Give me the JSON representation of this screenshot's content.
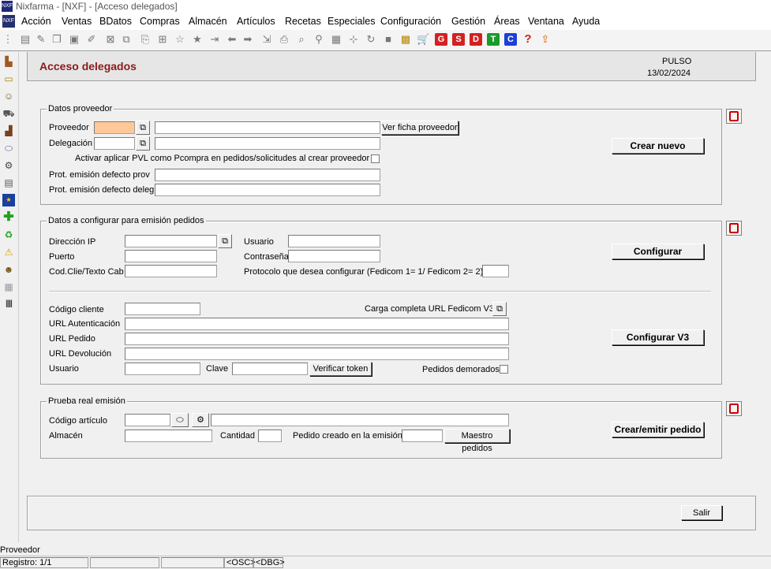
{
  "window": {
    "title": "Nixfarma - [NXF] - [Acceso delegados]",
    "icon_text": "NXF"
  },
  "menu": [
    "Acción",
    "Ventas",
    "BDatos",
    "Compras",
    "Almacén",
    "Artículos",
    "Recetas",
    "Especiales",
    "Configuración",
    "Gestión",
    "Áreas",
    "Ventana",
    "Ayuda"
  ],
  "toolbar": {
    "letter_buttons": [
      {
        "letter": "G",
        "color": "#d42020"
      },
      {
        "letter": "S",
        "color": "#d42020"
      },
      {
        "letter": "D",
        "color": "#d42020"
      },
      {
        "letter": "T",
        "color": "#1a9a2a"
      },
      {
        "letter": "C",
        "color": "#1c3fd6"
      }
    ],
    "help_glyph": "?"
  },
  "page": {
    "title": "Acceso delegados",
    "user": "PULSO",
    "date": "13/02/2024"
  },
  "datos_proveedor": {
    "title": "Datos proveedor",
    "proveedor_label": "Proveedor",
    "delegacion_label": "Delegación",
    "ver_ficha_label": "Ver ficha proveedor",
    "activar_label": "Activar aplicar PVL como Pcompra en pedidos/solicitudes al crear proveedor",
    "prot_prov_label": "Prot. emisión defecto prov",
    "prot_deleg_label": "Prot. emisión defecto deleg",
    "crear_nuevo_label": "Crear nuevo"
  },
  "configurar": {
    "title": "Datos a configurar para emisión pedidos",
    "direccion_ip_label": "Dirección IP",
    "usuario_label": "Usuario",
    "puerto_label": "Puerto",
    "contrasena_label": "Contraseña",
    "codclie_label": "Cod.Clie/Texto Cab",
    "protocolo_label": "Protocolo que desea configurar (Fedicom 1= 1/ Fedicom 2= 2)",
    "configurar_label": "Configurar",
    "codigo_cliente_label": "Código cliente",
    "carga_completa_label": "Carga completa URL Fedicom V3",
    "url_autenticacion_label": "URL Autenticación",
    "url_pedido_label": "URL Pedido",
    "url_devolucion_label": "URL Devolución",
    "usuario2_label": "Usuario",
    "clave_label": "Clave",
    "verificar_token_label": "Verificar token",
    "pedidos_demorados_label": "Pedidos demorados",
    "configurar_v3_label": "Configurar V3"
  },
  "prueba": {
    "title": "Prueba real emisión",
    "codigo_articulo_label": "Código artículo",
    "almacen_label": "Almacén",
    "cantidad_label": "Cantidad",
    "pedido_creado_label": "Pedido creado en la emisión",
    "maestro_pedidos_label": "Maestro pedidos",
    "crear_emitir_label": "Crear/emitir pedido"
  },
  "footer": {
    "salir_label": "Salir"
  },
  "status": {
    "field_label": "Proveedor",
    "registro": "Registro: 1/1",
    "osc": "<OSC>",
    "dbg": "<DBG>"
  }
}
